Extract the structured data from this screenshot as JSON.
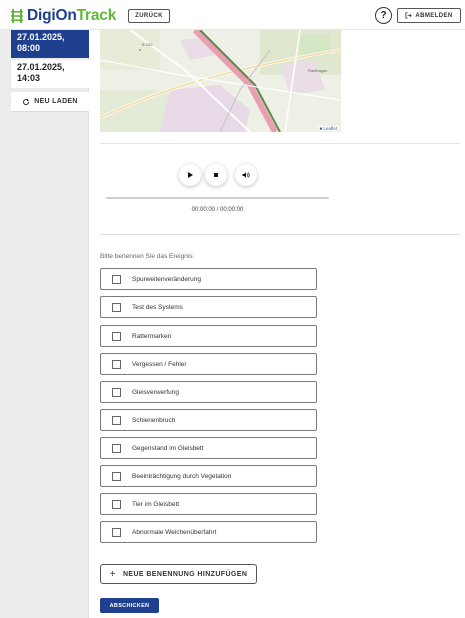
{
  "header": {
    "brand_part1": "DigiOn",
    "brand_part2": "Track",
    "back_label": "ZURÜCK",
    "help_label": "?",
    "logout_label": "ABMELDEN"
  },
  "sidebar": {
    "items": [
      {
        "label": "27.01.2025, 08:00",
        "active": true
      },
      {
        "label": "27.01.2025, 14:03",
        "active": false
      }
    ],
    "reload_label": "NEU LADEN"
  },
  "map": {
    "attribution": "Leaflet",
    "road_label": "B 100",
    "place_label": "Rasthagen"
  },
  "player": {
    "time": "00:00:00 / 00:00:00",
    "progress": 0
  },
  "form": {
    "question": "Bitte benennen Sie das Ereignis:",
    "options": [
      "Spurweitenveränderung",
      "Test des Systems",
      "Rattermarken",
      "Vergessen / Fehler",
      "Gleisverwerfung",
      "Schienenbruch",
      "Gegenstand im Gleisbett",
      "Beeinträchtigung durch Vegetation",
      "Tier im Gleisbett",
      "Abnormale Weichenüberfahrt"
    ],
    "add_label": "NEUE BENENNUNG HINZUFÜGEN",
    "submit_label": "ABSCHICKEN"
  },
  "colors": {
    "brand_blue": "#1f3f8f",
    "brand_green": "#5fb83a"
  }
}
